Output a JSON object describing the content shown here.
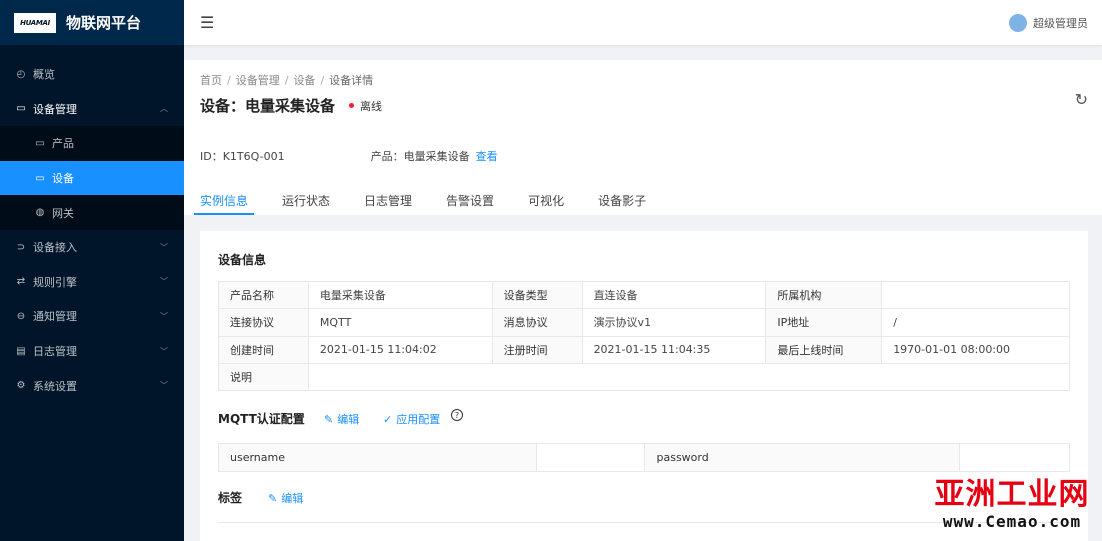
{
  "sidebar": {
    "logo_text": "HUAMAI",
    "title": "物联网平台",
    "items": [
      {
        "label": "概览",
        "icon": "dashboard-icon"
      },
      {
        "label": "设备管理",
        "icon": "device-icon"
      },
      {
        "label": "产品",
        "icon": "laptop-icon"
      },
      {
        "label": "设备",
        "icon": "monitor-icon"
      },
      {
        "label": "网关",
        "icon": "globe-icon"
      },
      {
        "label": "设备接入",
        "icon": "login-icon"
      },
      {
        "label": "规则引擎",
        "icon": "swap-icon"
      },
      {
        "label": "通知管理",
        "icon": "message-icon"
      },
      {
        "label": "日志管理",
        "icon": "calendar-icon"
      },
      {
        "label": "系统设置",
        "icon": "gear-icon"
      }
    ]
  },
  "header": {
    "user_name": "超级管理员"
  },
  "breadcrumb": [
    "首页",
    "设备管理",
    "设备",
    "设备详情"
  ],
  "page": {
    "title": "设备：电量采集设备",
    "status": "离线",
    "id_text": "ID：K1T6Q-001",
    "product_text": "产品：电量采集设备",
    "view_link": "查看"
  },
  "tabs": [
    "实例信息",
    "运行状态",
    "日志管理",
    "告警设置",
    "可视化",
    "设备影子"
  ],
  "device_info": {
    "title": "设备信息",
    "rows": [
      [
        "产品名称",
        "电量采集设备",
        "设备类型",
        "直连设备",
        "所属机构",
        ""
      ],
      [
        "连接协议",
        "MQTT",
        "消息协议",
        "演示协议v1",
        "IP地址",
        "/"
      ],
      [
        "创建时间",
        "2021-01-15 11:04:02",
        "注册时间",
        "2021-01-15 11:04:35",
        "最后上线时间",
        "1970-01-01 08:00:00"
      ],
      [
        "说明",
        ""
      ]
    ]
  },
  "mqtt": {
    "title": "MQTT认证配置",
    "edit": "编辑",
    "apply": "应用配置",
    "cells": [
      "username",
      "",
      "password",
      ""
    ]
  },
  "tags": {
    "title": "标签",
    "edit": "编辑"
  },
  "watermark": {
    "cn": "亚洲工业网",
    "url": "www.Cemao.com"
  },
  "colors": {
    "sidebar_bg": "#001529",
    "accent": "#1890ff",
    "offline_dot": "#f5222d",
    "watermark_red": "#e60012"
  }
}
